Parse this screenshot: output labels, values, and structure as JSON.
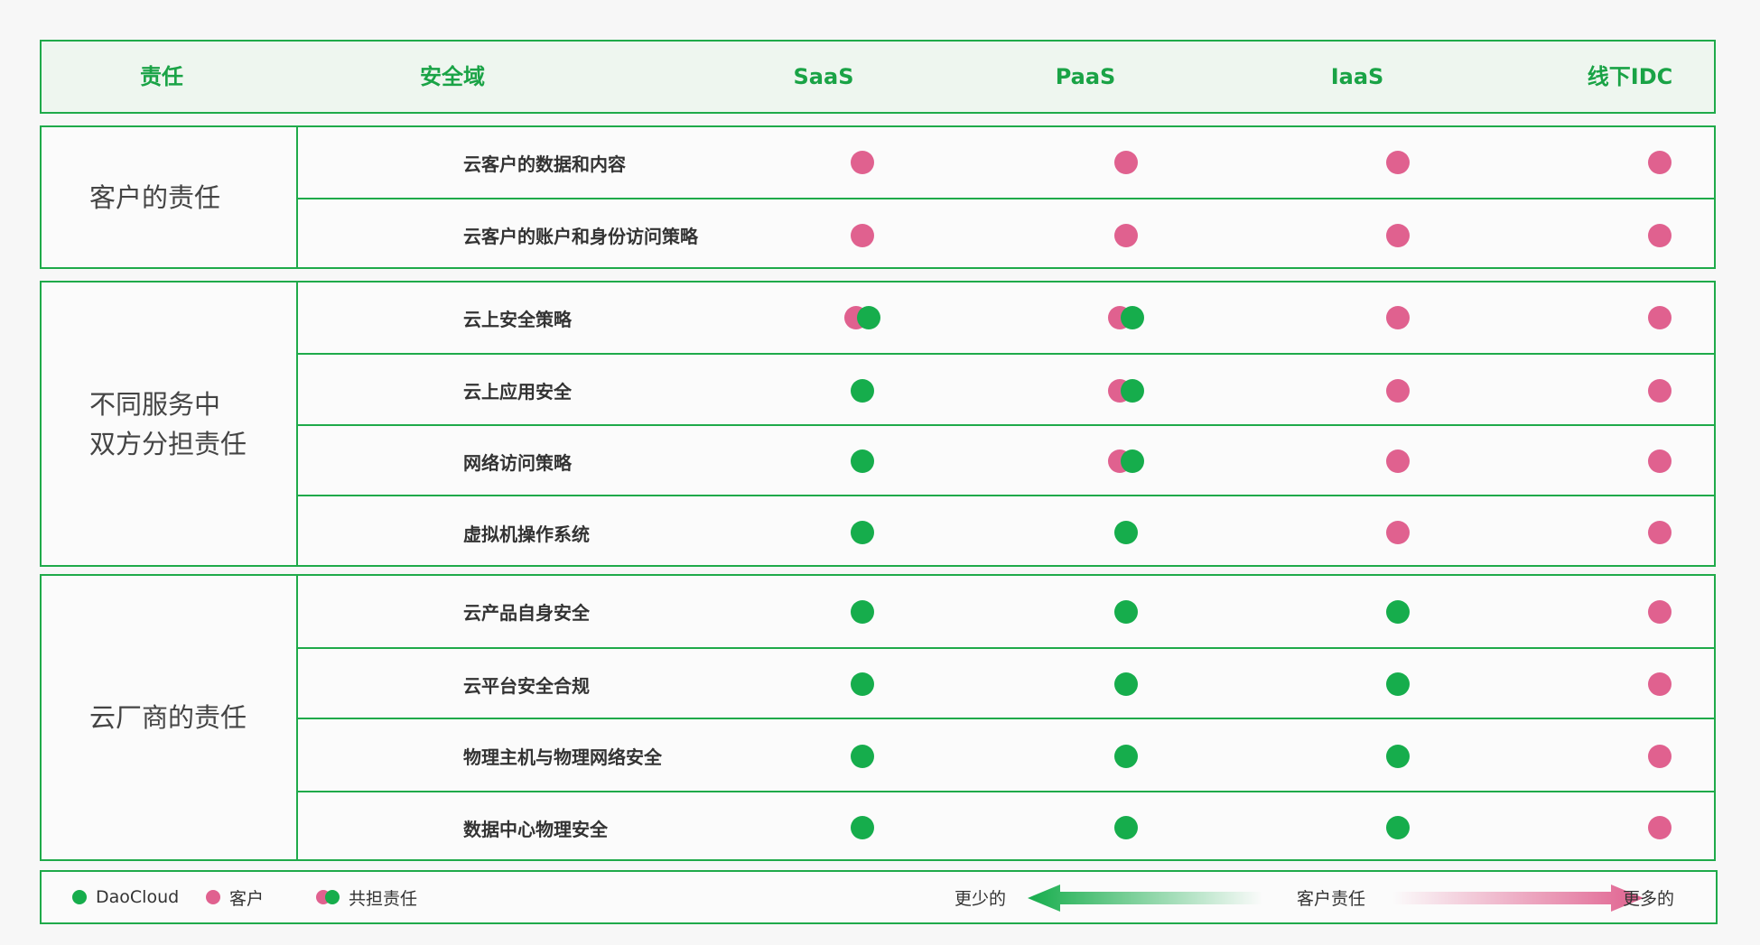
{
  "header": {
    "responsibility": "责任",
    "domain": "安全域",
    "saas": "SaaS",
    "paas": "PaaS",
    "iaas": "IaaS",
    "idc": "线下IDC"
  },
  "groups": [
    {
      "title": "客户的责任",
      "rows": [
        {
          "domain": "云客户的数据和内容",
          "cells": [
            "customer",
            "customer",
            "customer",
            "customer"
          ]
        },
        {
          "domain": "云客户的账户和身份访问策略",
          "cells": [
            "customer",
            "customer",
            "customer",
            "customer"
          ]
        }
      ]
    },
    {
      "title": "不同服务中\n双方分担责任",
      "rows": [
        {
          "domain": "云上安全策略",
          "cells": [
            "shared",
            "shared",
            "customer",
            "customer"
          ]
        },
        {
          "domain": "云上应用安全",
          "cells": [
            "daocloud",
            "shared",
            "customer",
            "customer"
          ]
        },
        {
          "domain": "网络访问策略",
          "cells": [
            "daocloud",
            "shared",
            "customer",
            "customer"
          ]
        },
        {
          "domain": "虚拟机操作系统",
          "cells": [
            "daocloud",
            "daocloud",
            "customer",
            "customer"
          ]
        }
      ]
    },
    {
      "title": "云厂商的责任",
      "rows": [
        {
          "domain": "云产品自身安全",
          "cells": [
            "daocloud",
            "daocloud",
            "daocloud",
            "customer"
          ]
        },
        {
          "domain": "云平台安全合规",
          "cells": [
            "daocloud",
            "daocloud",
            "daocloud",
            "customer"
          ]
        },
        {
          "domain": "物理主机与物理网络安全",
          "cells": [
            "daocloud",
            "daocloud",
            "daocloud",
            "customer"
          ]
        },
        {
          "domain": "数据中心物理安全",
          "cells": [
            "daocloud",
            "daocloud",
            "daocloud",
            "customer"
          ]
        }
      ]
    }
  ],
  "legend": {
    "daocloud": "DaoCloud",
    "customer": "客户",
    "shared": "共担责任",
    "less": "更少的",
    "customer_resp": "客户责任",
    "more": "更多的"
  },
  "colors": {
    "accent": "#1faa4a",
    "daocloud": "#16ad4c",
    "customer": "#e0618f"
  }
}
